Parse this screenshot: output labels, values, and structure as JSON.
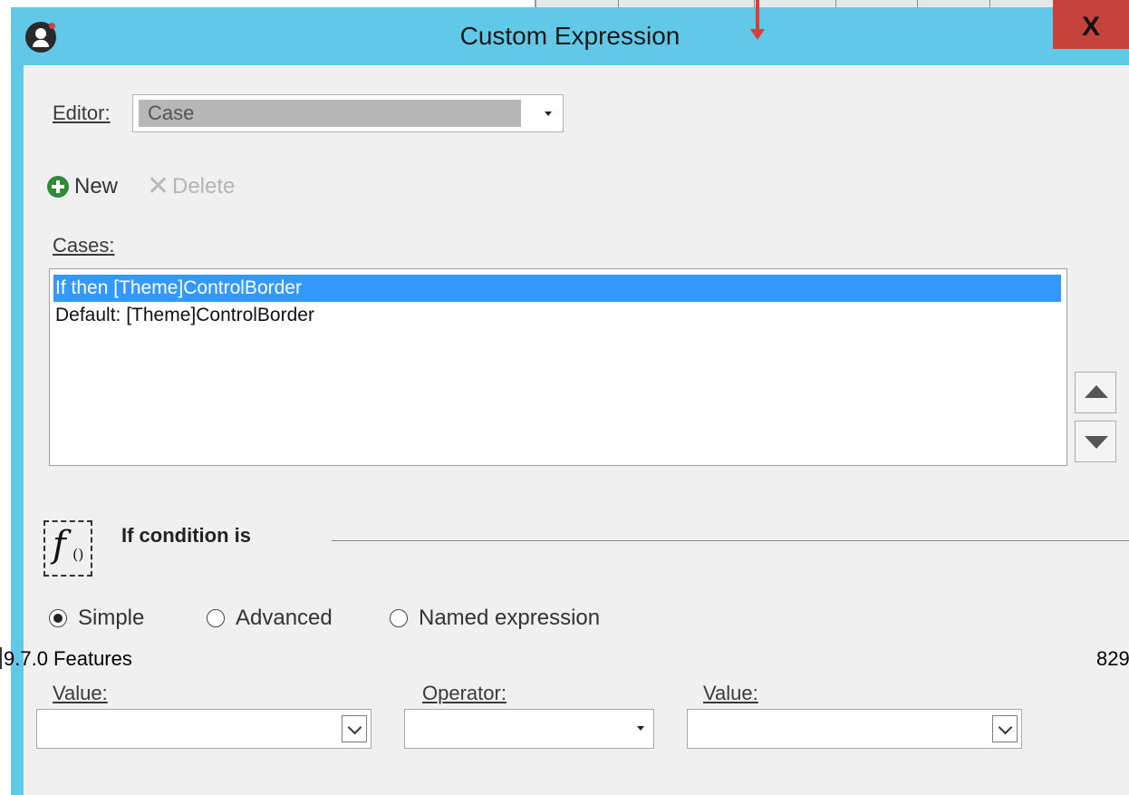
{
  "window": {
    "title": "Custom Expression",
    "close_label": "X"
  },
  "editor": {
    "label": "Editor:",
    "value": "Case"
  },
  "toolbar": {
    "new_label": "New",
    "delete_label": "Delete"
  },
  "cases": {
    "label": "Cases:",
    "items": [
      {
        "label": "If  then [Theme]ControlBorder",
        "selected": true
      },
      {
        "label": "Default: [Theme]ControlBorder",
        "selected": false
      }
    ]
  },
  "condition": {
    "title": "If condition is",
    "options": [
      {
        "label": "Simple",
        "checked": true
      },
      {
        "label": "Advanced",
        "checked": false
      },
      {
        "label": "Named expression",
        "checked": false
      }
    ]
  },
  "fields": {
    "value1_label": "Value:",
    "operator_label": "Operator:",
    "value2_label": "Value:",
    "value1": "",
    "operator": "",
    "value2": ""
  },
  "page_footer": {
    "left": "9.7.0 Features",
    "right": "829"
  },
  "colors": {
    "titlebar": "#62c8e8",
    "close_button": "#c4433b",
    "selection": "#3399ff",
    "new_icon": "#2e8b3a"
  }
}
